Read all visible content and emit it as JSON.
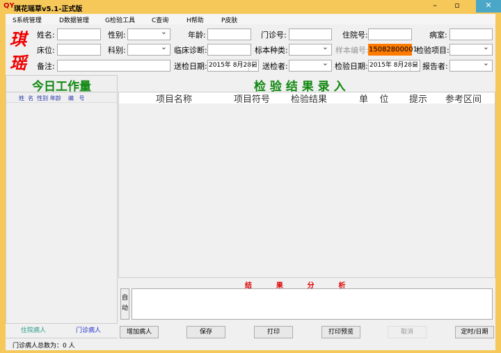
{
  "window": {
    "title": "琪花瑶草v5.1-正式版",
    "icon": "QY",
    "controls": [
      "minimize",
      "maximize",
      "close"
    ]
  },
  "menu": [
    "S系统管理",
    "D数据管理",
    "G检验工具",
    "C查询",
    "H帮助",
    "P皮肤"
  ],
  "logo": [
    "琪",
    "瑶"
  ],
  "form": {
    "name": "姓名:",
    "sex": "性别:",
    "age": "年龄:",
    "outpatient_no": "门诊号:",
    "inpatient_no": "住院号:",
    "ward": "病室:",
    "bed": "床位:",
    "department": "科别:",
    "diagnosis": "临床诊断:",
    "specimen_type": "标本种类:",
    "sample_no": "样本编号:",
    "sample_no_value": "15082800001",
    "test_item": "检验项目:",
    "remark": "备注:",
    "send_date": "送检日期:",
    "send_date_value": "2015年  8月28日",
    "sender": "送检者:",
    "test_date": "检验日期:",
    "test_date_value": "2015年  8月28日",
    "reporter": "报告者:"
  },
  "left": {
    "title": "今日工作量",
    "headers": "姓  名  性别 年龄    编   号",
    "tabs": [
      "住院病人",
      "门诊病人"
    ],
    "status": "门诊病人总数为：0 人"
  },
  "main": {
    "title": "检 验 结 果 录 入",
    "columns": [
      "项目名称",
      "项目符号",
      "检验结果",
      "单    位",
      "提示",
      "参考区间"
    ],
    "analysis_title": "结          果          分          析",
    "auto_label": [
      "自",
      "动"
    ]
  },
  "buttons": {
    "add": "增加病人",
    "save": "保存",
    "print": "打印",
    "preview": "打印预览",
    "cancel": "取消",
    "timer": "定时/日期"
  },
  "colors": {
    "frame": "#f6c85a",
    "accent_green": "#118811",
    "red": "#e00000",
    "sample_bg": "#ff7a00"
  }
}
